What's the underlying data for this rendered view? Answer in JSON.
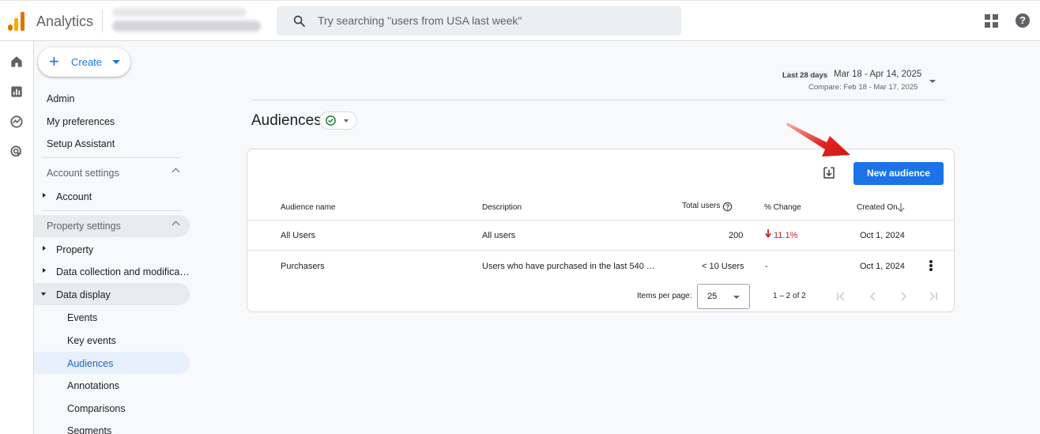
{
  "header": {
    "app_name": "Analytics",
    "search_placeholder": "Try searching \"users from USA last week\""
  },
  "sidebar": {
    "create_label": "Create",
    "items": [
      "Admin",
      "My preferences",
      "Setup Assistant"
    ],
    "account_settings": {
      "label": "Account settings",
      "items": [
        "Account"
      ]
    },
    "property_settings": {
      "label": "Property settings",
      "items": [
        "Property",
        "Data collection and modifica…",
        "Data display"
      ],
      "data_display_items": [
        "Events",
        "Key events",
        "Audiences",
        "Annotations",
        "Comparisons",
        "Segments"
      ],
      "active_item": "Audiences"
    }
  },
  "date": {
    "tag": "Last 28 days",
    "range": "Mar 18 - Apr 14, 2025",
    "compare": "Compare: Feb 18 - Mar 17, 2025"
  },
  "page": {
    "title": "Audiences"
  },
  "card": {
    "new_button": "New audience",
    "columns": [
      "Audience name",
      "Description",
      "Total users",
      "% Change",
      "Created On"
    ],
    "rows": [
      {
        "name": "All Users",
        "description": "All users",
        "total_users": "200",
        "change": "11.1%",
        "created_on": "Oct 1, 2024"
      },
      {
        "name": "Purchasers",
        "description": "Users who have purchased in the last 540 …",
        "total_users": "< 10 Users",
        "change": "-",
        "created_on": "Oct 1, 2024"
      }
    ],
    "pagination": {
      "items_per_page_label": "Items per page:",
      "items_per_page": "25",
      "range": "1 – 2 of 2"
    }
  },
  "colors": {
    "accent": "#1a73e8",
    "negative": "#c5221f",
    "success": "#188038",
    "annotation_arrow": "#e52320"
  }
}
